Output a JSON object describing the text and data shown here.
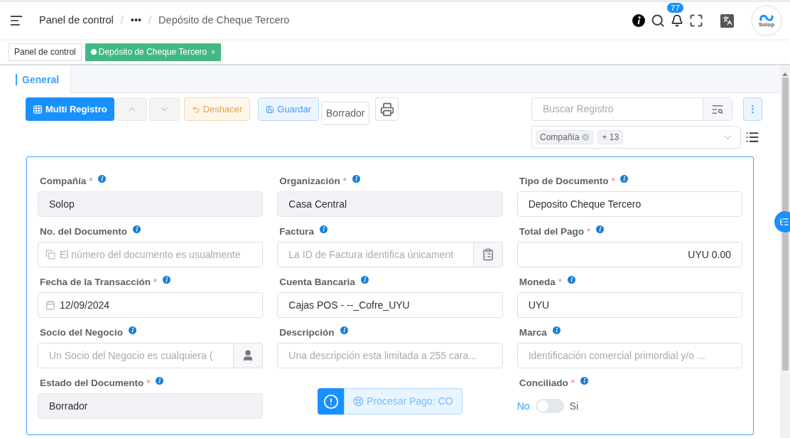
{
  "header": {
    "breadcrumb": [
      {
        "label": "Panel de control",
        "kind": "link"
      },
      {
        "label": "•••",
        "kind": "ellipsis"
      },
      {
        "label": "Depósito de Cheque Tercero",
        "kind": "current"
      }
    ],
    "separator": "/",
    "notifications": "77",
    "logo": "Solop"
  },
  "required_mark": "*",
  "open_tabs": [
    {
      "label": "Panel de control",
      "selected": false
    },
    {
      "label": "Depósito de Cheque Tercero",
      "selected": true,
      "close": "×"
    }
  ],
  "section_tabs": [
    {
      "label": "General",
      "selected": true
    }
  ],
  "toolbar": {
    "buttons": [
      {
        "kind": "primary",
        "label": "Multi Registro",
        "disabled": false
      },
      {
        "kind": "up",
        "disabled": true
      },
      {
        "kind": "down",
        "disabled": true
      },
      {
        "kind": "warning",
        "label": "Deshacer",
        "disabled": false
      },
      {
        "kind": "info",
        "label": "Guardar",
        "disabled": false
      },
      {
        "kind": "status",
        "label": "Borrador",
        "disabled": false
      },
      {
        "kind": "print",
        "disabled": false
      }
    ],
    "search": {
      "placeholder": "Buscar Registro"
    },
    "filter_tags": [
      "Compañía",
      "+ 13"
    ]
  },
  "fields": [
    {
      "kind": "field",
      "label": "Compañía",
      "required": true,
      "readonly": true,
      "value": "Solop"
    },
    {
      "kind": "field",
      "label": "Organización",
      "required": true,
      "readonly": true,
      "value": "Casa Central"
    },
    {
      "kind": "field",
      "label": "Tipo de Documento",
      "required": true,
      "readonly": false,
      "value": "Deposito Cheque Tercero"
    },
    {
      "kind": "doc",
      "label": "No. del Documento",
      "required": false,
      "readonly": false,
      "placeholder": "El número del documento es usualmente"
    },
    {
      "kind": "clipboard",
      "label": "Factura",
      "required": false,
      "readonly": false,
      "placeholder": "La ID de Factura identifica únicament"
    },
    {
      "kind": "amount",
      "label": "Total del Pago",
      "required": true,
      "readonly": false,
      "value": "UYU 0.00"
    },
    {
      "kind": "date",
      "label": "Fecha de la Transacción",
      "required": true,
      "readonly": false,
      "value": "12/09/2024"
    },
    {
      "kind": "field",
      "label": "Cuenta Bancaria",
      "required": false,
      "readonly": false,
      "value": "Cajas POS - --_Cofre_UYU"
    },
    {
      "kind": "field",
      "label": "Moneda",
      "required": true,
      "readonly": false,
      "value": "UYU"
    },
    {
      "kind": "person",
      "label": "Socio del Negocio",
      "required": false,
      "readonly": false,
      "placeholder": "Un Socio del Negocio es cualquiera ("
    },
    {
      "kind": "field",
      "label": "Descripción",
      "required": false,
      "readonly": false,
      "placeholder": "Una descripción esta limitada a 255 cara..."
    },
    {
      "kind": "field",
      "label": "Marca",
      "required": false,
      "readonly": false,
      "placeholder": "Identificación comercial primordial y/o ..."
    },
    {
      "kind": "field",
      "label": "Estado del Documento",
      "required": true,
      "readonly": true,
      "value": "Borrador"
    },
    {
      "kind": "action",
      "label": "Procesar Pago: CO"
    },
    {
      "kind": "switch",
      "label": "Conciliado",
      "required": true,
      "on": false,
      "off_label": "No",
      "on_label": "Si"
    }
  ]
}
